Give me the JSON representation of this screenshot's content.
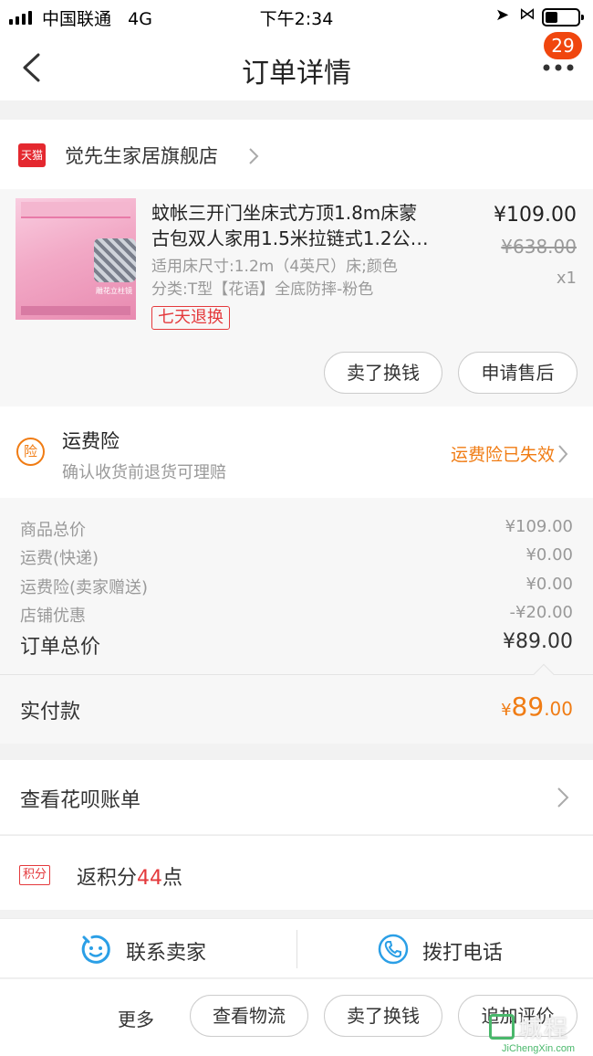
{
  "status_bar": {
    "carrier": "中国联通",
    "network": "4G",
    "time": "下午2:34"
  },
  "nav": {
    "title": "订单详情",
    "badge_count": "29"
  },
  "shop": {
    "platform_icon_text": "天猫",
    "name": "觉先生家居旗舰店"
  },
  "product": {
    "title_line1": "蚊帐三开门坐床式方顶1.8m床蒙",
    "title_line2": "古包双人家用1.5米拉链式1.2公…",
    "spec_line1": "适用床尺寸:1.2m（4英尺）床;颜色",
    "spec_line2": "分类:T型【花语】全底防摔-粉色",
    "tag": "七天退换",
    "price": "¥109.00",
    "original_price": "¥638.00",
    "quantity": "x1",
    "image_caption": "雕花立柱镜",
    "sell_button": "卖了换钱",
    "after_sale_button": "申请售后"
  },
  "insurance": {
    "icon_text": "险",
    "title": "运费险",
    "description": "确认收货前退货可理赔",
    "status": "运费险已失效"
  },
  "summary": {
    "rows": [
      {
        "label": "商品总价",
        "value": "¥109.00"
      },
      {
        "label": "运费(快递)",
        "value": "¥0.00"
      },
      {
        "label": "运费险(卖家赠送)",
        "value": "¥0.00"
      },
      {
        "label": "店铺优惠",
        "value": "-¥20.00"
      }
    ],
    "total_label": "订单总价",
    "total_value": "¥89.00"
  },
  "paid": {
    "label": "实付款",
    "currency": "¥",
    "integer": "89",
    "decimal": ".00"
  },
  "huabei": {
    "label": "查看花呗账单"
  },
  "points": {
    "tag": "积分",
    "prefix": "返积分",
    "count": "44",
    "suffix": "点"
  },
  "contact": {
    "seller_label": "联系卖家",
    "phone_label": "拨打电话"
  },
  "actions": {
    "more_label": "更多",
    "logistics_button": "查看物流",
    "sell_button": "卖了换钱",
    "review_button": "追加评价"
  },
  "watermark": {
    "text": "城程",
    "sub": "JiChengXin.com"
  },
  "colors": {
    "accent_orange": "#f07c14",
    "tmall_red": "#e4282f",
    "badge": "#f0460e",
    "contact_blue": "#2b9fe6"
  }
}
